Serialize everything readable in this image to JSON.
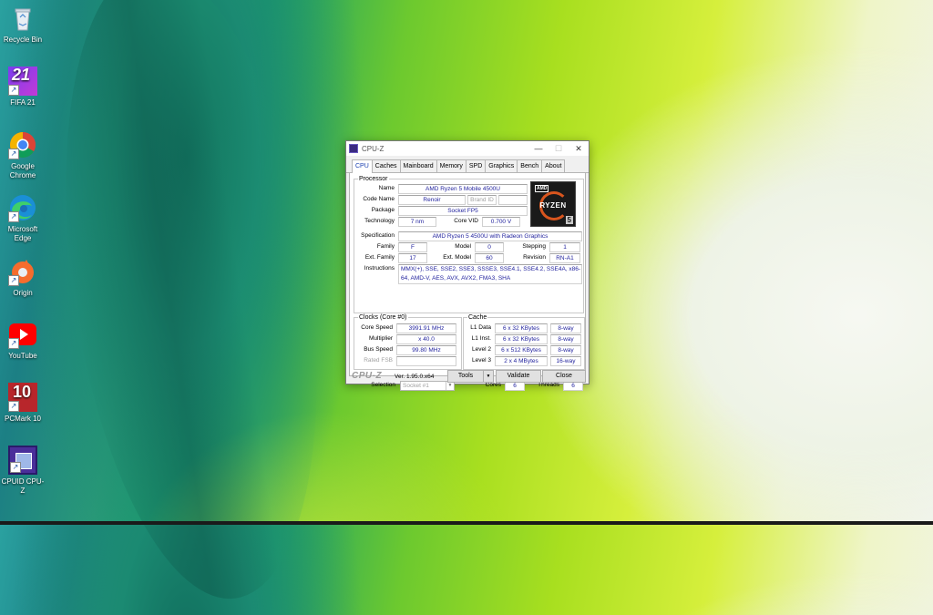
{
  "desktop": {
    "icons": [
      {
        "label": "Recycle Bin",
        "icon": "recycle-bin-icon"
      },
      {
        "label": "FIFA 21",
        "icon": "fifa-21-icon"
      },
      {
        "label": "Google Chrome",
        "icon": "chrome-icon"
      },
      {
        "label": "Microsoft Edge",
        "icon": "edge-icon"
      },
      {
        "label": "Origin",
        "icon": "origin-icon"
      },
      {
        "label": "YouTube",
        "icon": "youtube-icon"
      },
      {
        "label": "PCMark 10",
        "icon": "pcmark-10-icon"
      },
      {
        "label": "CPUID CPU-Z",
        "icon": "cpuz-icon"
      }
    ],
    "fifa_badge": "21",
    "pcmark_badge": "10"
  },
  "window": {
    "title": "CPU-Z",
    "controls": {
      "minimize": "—",
      "maximize": "☐",
      "close": "✕"
    },
    "tabs": [
      "CPU",
      "Caches",
      "Mainboard",
      "Memory",
      "SPD",
      "Graphics",
      "Bench",
      "About"
    ],
    "active_tab": "CPU",
    "processor": {
      "group_label": "Processor",
      "name_label": "Name",
      "name": "AMD Ryzen 5 Mobile 4500U",
      "codename_label": "Code Name",
      "codename": "Renoir",
      "brandid_label": "Brand ID",
      "package_label": "Package",
      "package": "Socket FP5",
      "technology_label": "Technology",
      "technology": "7 nm",
      "corevid_label": "Core VID",
      "corevid": "0.700 V",
      "spec_label": "Specification",
      "spec": "AMD Ryzen 5 4500U with Radeon Graphics",
      "family_label": "Family",
      "family": "F",
      "model_label": "Model",
      "model": "0",
      "stepping_label": "Stepping",
      "stepping": "1",
      "extfamily_label": "Ext. Family",
      "extfamily": "17",
      "extmodel_label": "Ext. Model",
      "extmodel": "60",
      "revision_label": "Revision",
      "revision": "RN-A1",
      "instructions_label": "Instructions",
      "instructions": "MMX(+), SSE, SSE2, SSE3, SSSE3, SSE4.1, SSE4.2, SSE4A, x86-64, AMD-V, AES, AVX, AVX2, FMA3, SHA",
      "logo": {
        "brand": "AMD",
        "name": "RYZEN",
        "tier": "5"
      }
    },
    "clocks": {
      "group_label": "Clocks (Core #0)",
      "corespeed_label": "Core Speed",
      "corespeed": "3991.91 MHz",
      "multiplier_label": "Multiplier",
      "multiplier": "x 40.0",
      "busspeed_label": "Bus Speed",
      "busspeed": "99.80 MHz",
      "ratedfsb_label": "Rated FSB"
    },
    "cache": {
      "group_label": "Cache",
      "rows": [
        {
          "label": "L1 Data",
          "size": "6 x 32 KBytes",
          "way": "8-way"
        },
        {
          "label": "L1 Inst.",
          "size": "6 x 32 KBytes",
          "way": "8-way"
        },
        {
          "label": "Level 2",
          "size": "6 x 512 KBytes",
          "way": "8-way"
        },
        {
          "label": "Level 3",
          "size": "2 x 4 MBytes",
          "way": "16-way"
        }
      ]
    },
    "selection": {
      "label": "Selection",
      "value": "Socket #1",
      "cores_label": "Cores",
      "cores": "6",
      "threads_label": "Threads",
      "threads": "6"
    },
    "footer": {
      "logo": "CPU-Z",
      "version": "Ver. 1.95.0.x64",
      "tools": "Tools",
      "validate": "Validate",
      "close": "Close"
    }
  }
}
